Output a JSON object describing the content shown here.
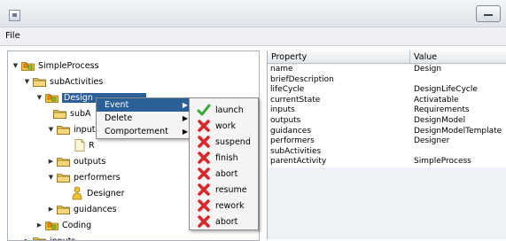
{
  "window": {
    "icon": "java-window-icon",
    "minimize_icon": "minimize-icon"
  },
  "menubar": {
    "file": "File"
  },
  "tree": {
    "nodes": [
      {
        "label": "SimpleProcess",
        "toggle": "▼",
        "icon": "package-folder-icon"
      },
      {
        "label": "subActivities",
        "toggle": "▼",
        "icon": "folder-icon"
      },
      {
        "label": "Design",
        "toggle": "▼",
        "icon": "package-folder-icon"
      },
      {
        "label": "subA",
        "toggle": "",
        "icon": "folder-icon"
      },
      {
        "label": "inputs",
        "toggle": "▼",
        "icon": "folder-icon"
      },
      {
        "label": "R",
        "toggle": "",
        "icon": "document-icon"
      },
      {
        "label": "outputs",
        "toggle": "▶",
        "icon": "folder-icon"
      },
      {
        "label": "performers",
        "toggle": "▼",
        "icon": "folder-icon"
      },
      {
        "label": "Designer",
        "toggle": "",
        "icon": "person-icon"
      },
      {
        "label": "guidances",
        "toggle": "▶",
        "icon": "folder-icon"
      },
      {
        "label": "Coding",
        "toggle": "▶",
        "icon": "package-folder-icon"
      },
      {
        "label": "inputs",
        "toggle": "▶",
        "icon": "folder-icon"
      }
    ]
  },
  "properties": {
    "col_property": "Property",
    "col_value": "Value",
    "rows": [
      {
        "p": "name",
        "v": "Design"
      },
      {
        "p": "briefDescription",
        "v": ""
      },
      {
        "p": "lifeCycle",
        "v": "DesignLifeCycle"
      },
      {
        "p": "currentState",
        "v": "Activatable"
      },
      {
        "p": "inputs",
        "v": "Requirements"
      },
      {
        "p": "outputs",
        "v": "DesignModel"
      },
      {
        "p": "guidances",
        "v": "DesignModelTemplate"
      },
      {
        "p": "performers",
        "v": "Designer"
      },
      {
        "p": "subActivities",
        "v": ""
      },
      {
        "p": "parentActivity",
        "v": "SimpleProcess"
      }
    ]
  },
  "context_menu": {
    "items": [
      {
        "label": "Event",
        "arrow": "▶"
      },
      {
        "label": "Delete",
        "arrow": "▶"
      },
      {
        "label": "Comportement",
        "arrow": "▶"
      }
    ]
  },
  "submenu": {
    "items": [
      {
        "label": "launch",
        "icon": "green-check-icon"
      },
      {
        "label": "work",
        "icon": "red-x-icon"
      },
      {
        "label": "suspend",
        "icon": "red-x-icon"
      },
      {
        "label": "finish",
        "icon": "red-x-icon"
      },
      {
        "label": "abort",
        "icon": "red-x-icon"
      },
      {
        "label": "resume",
        "icon": "red-x-icon"
      },
      {
        "label": "rework",
        "icon": "red-x-icon"
      },
      {
        "label": "abort",
        "icon": "red-x-icon"
      }
    ]
  },
  "colors": {
    "selection": "#2b5f98",
    "folder": "#e9c65a",
    "package": "#f3c02e",
    "check": "#3aa635",
    "cross": "#d8282b"
  }
}
